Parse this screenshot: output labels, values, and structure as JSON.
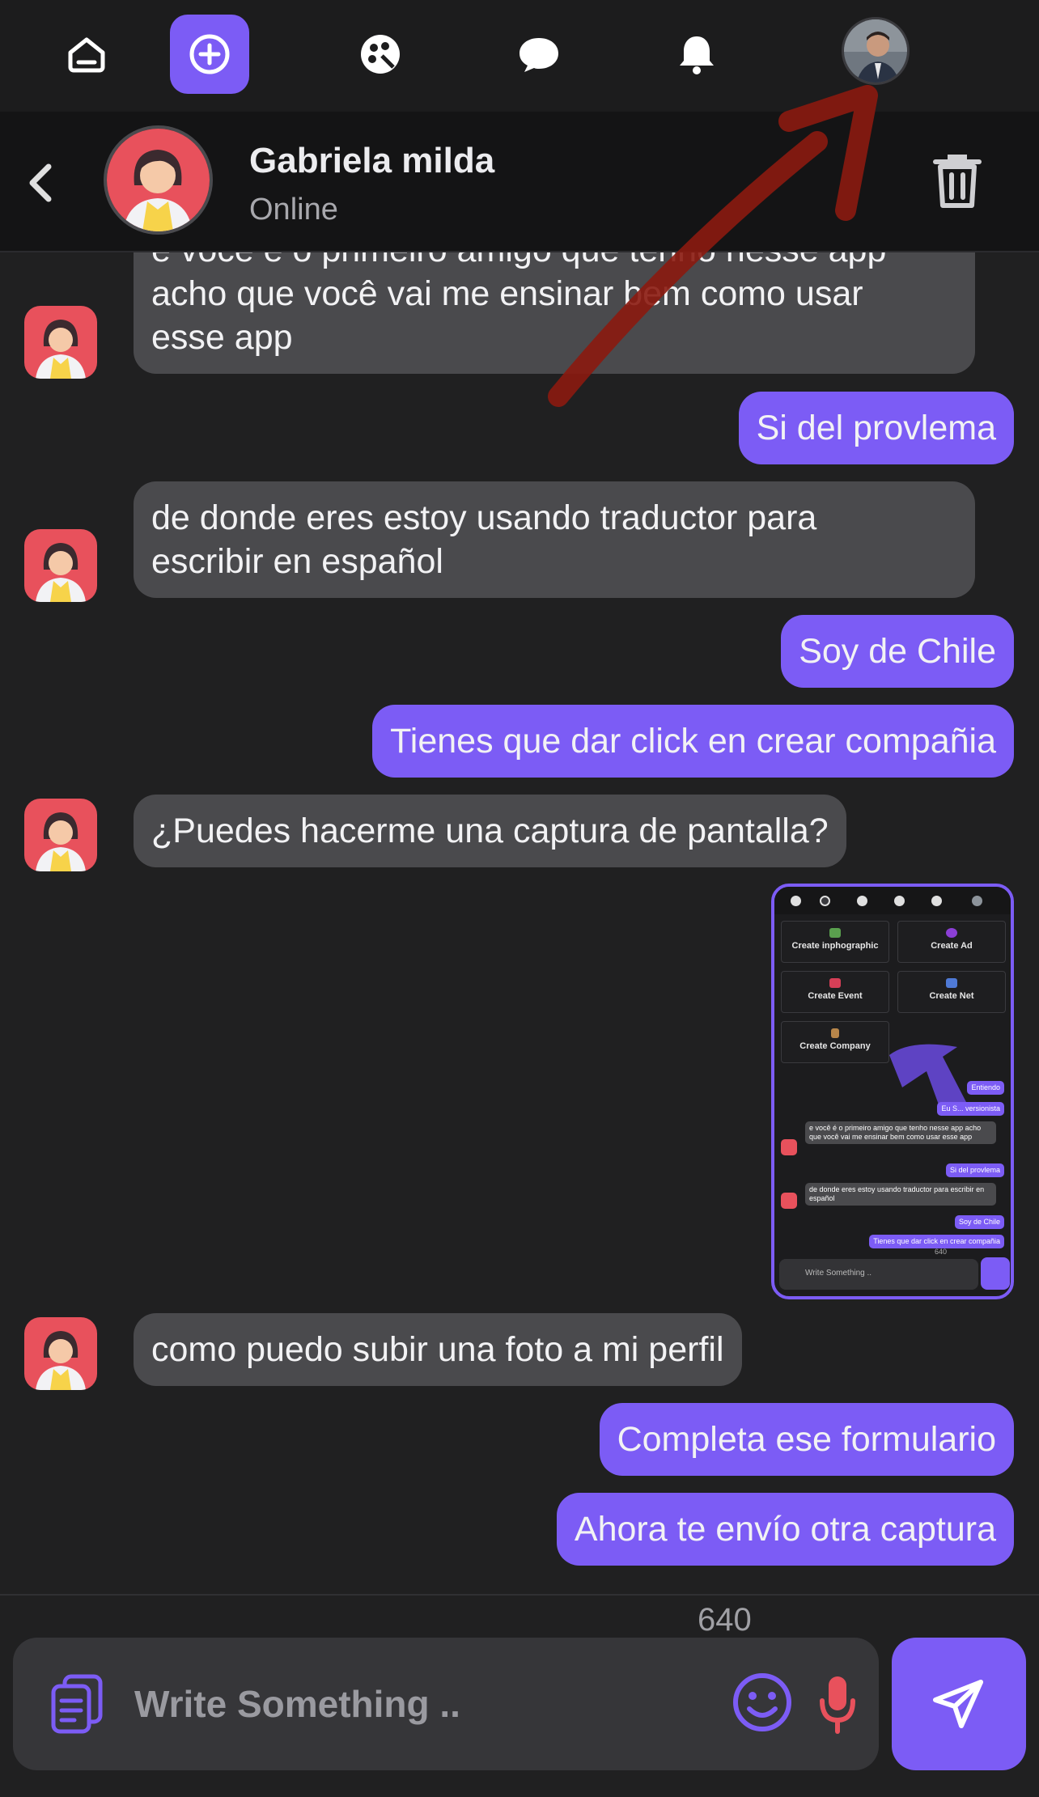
{
  "nav": {
    "items": [
      {
        "name": "home-icon"
      },
      {
        "name": "plus-circle-icon",
        "active": true
      },
      {
        "name": "palette-icon"
      },
      {
        "name": "chat-bubble-icon"
      },
      {
        "name": "bell-icon"
      }
    ],
    "profile_avatar": "profile-avatar"
  },
  "header": {
    "name": "Gabriela milda",
    "status": "Online"
  },
  "messages": {
    "m1": "e você é o primeiro amigo que tenho nesse app\nacho que você vai me ensinar bem como usar\nesse app",
    "m2": "Si del provlema",
    "m3": "de donde eres estoy usando traductor para\nescribir en español",
    "m4": "Soy de Chile",
    "m5": "Tienes que dar click en crear compañia",
    "m6": "¿Puedes hacerme una captura de pantalla?",
    "m8": "como puedo subir una foto a mi perfil",
    "m9": "Completa ese formulario",
    "m10": "Ahora te envío otra captura"
  },
  "screenshot": {
    "cards": {
      "c1": "Create inphographic",
      "c2": "Create Ad",
      "c3": "Create Event",
      "c4": "Create Net",
      "c5": "Create Company"
    },
    "bubbles": {
      "b1": "Entiendo",
      "b2": "Eu S... versionista",
      "b3": "e você é o primeiro amigo que tenho nesse app acho que você vai me ensinar bem como usar esse app",
      "b4": "Si del provlema",
      "b5": "de donde eres estoy usando traductor para escribir en español",
      "b6": "Soy de Chile",
      "b7": "Tienes que dar click en crear compañia"
    },
    "count": "640",
    "input_placeholder": "Write Something .."
  },
  "composer": {
    "char_count": "640",
    "placeholder": "Write Something .."
  },
  "colors": {
    "accent": "#7c5cf5",
    "incoming_bubble": "#4a4a4d",
    "background": "#202021",
    "mic": "#e8515c",
    "annotation": "#8b1a10"
  }
}
